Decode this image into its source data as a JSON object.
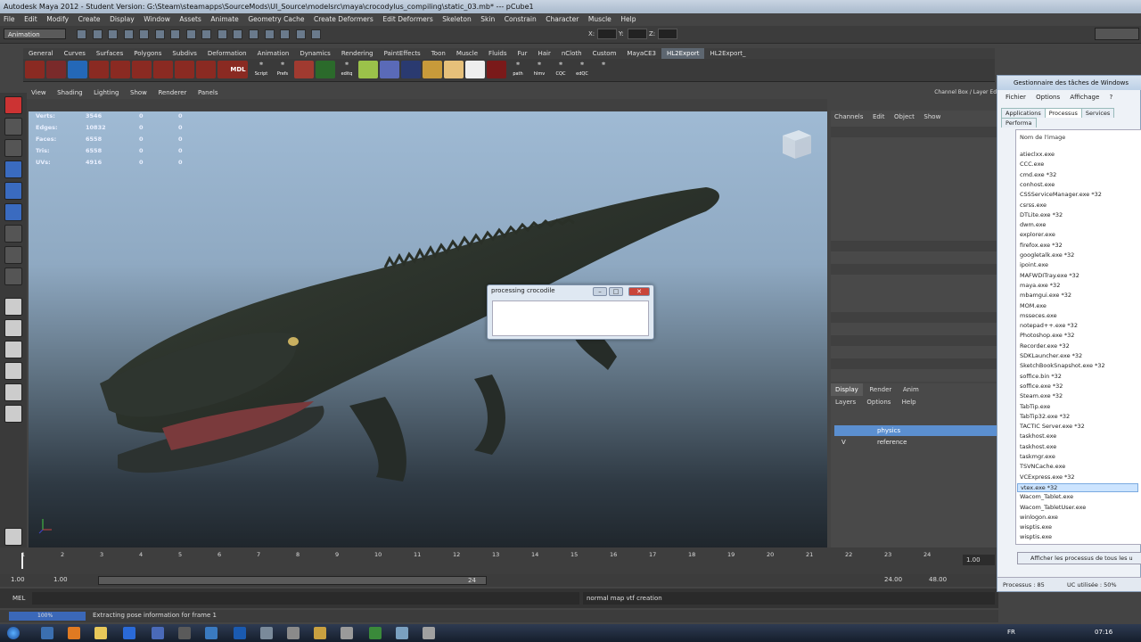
{
  "window_title": "Autodesk Maya 2012 - Student Version: G:\\Steam\\steamapps\\SourceMods\\UI_Source\\modelsrc\\maya\\crocodylus_compiling\\static_03.mb* --- pCube1",
  "menus": [
    "File",
    "Edit",
    "Modify",
    "Create",
    "Display",
    "Window",
    "Assets",
    "Animate",
    "Geometry Cache",
    "Create Deformers",
    "Edit Deformers",
    "Skeleton",
    "Skin",
    "Constrain",
    "Character",
    "Muscle",
    "Help"
  ],
  "mode_dropdown": "Animation",
  "coord_labels": [
    "X:",
    "Y:",
    "Z:"
  ],
  "shelf_tabs": [
    "General",
    "Curves",
    "Surfaces",
    "Polygons",
    "Subdivs",
    "Deformation",
    "Animation",
    "Dynamics",
    "Rendering",
    "PaintEffects",
    "Toon",
    "Muscle",
    "Fluids",
    "Fur",
    "Hair",
    "nCloth",
    "Custom",
    "MayaCE3",
    "HL2Export",
    "HL2Export_"
  ],
  "active_shelf_tab": "HL2Export",
  "shelf_labels": [
    "Script",
    "Prefs",
    "editq",
    "path",
    "hlmv",
    "CQC",
    "edQC",
    "MDL"
  ],
  "panel_menu": [
    "View",
    "Shading",
    "Lighting",
    "Show",
    "Renderer",
    "Panels"
  ],
  "hud": [
    {
      "label": "Verts:",
      "v1": "3546",
      "v2": "0",
      "v3": "0"
    },
    {
      "label": "Edges:",
      "v1": "10832",
      "v2": "0",
      "v3": "0"
    },
    {
      "label": "Faces:",
      "v1": "6558",
      "v2": "0",
      "v3": "0"
    },
    {
      "label": "Tris:",
      "v1": "6558",
      "v2": "0",
      "v3": "0"
    },
    {
      "label": "UVs:",
      "v1": "4916",
      "v2": "0",
      "v3": "0"
    }
  ],
  "dialog": {
    "title": "processing crocodile"
  },
  "channel_box_header": "Channel Box / Layer Ed",
  "channel_menu": [
    "Channels",
    "Edit",
    "Object",
    "Show"
  ],
  "layer_tabs": [
    "Display",
    "Render",
    "Anim"
  ],
  "layer_menu": [
    "Layers",
    "Options",
    "Help"
  ],
  "layers": [
    {
      "name": "physics",
      "v": ""
    },
    {
      "name": "reference",
      "v": "V"
    }
  ],
  "timeline_ticks": [
    "1",
    "2",
    "3",
    "4",
    "5",
    "6",
    "7",
    "8",
    "9",
    "10",
    "11",
    "12",
    "13",
    "14",
    "15",
    "16",
    "17",
    "18",
    "19",
    "20",
    "21",
    "22",
    "23",
    "24"
  ],
  "current_frame": "1.00",
  "range": {
    "start": "1.00",
    "start2": "1.00",
    "mid": "24",
    "end": "24.00",
    "end2": "48.00"
  },
  "mel_label": "MEL",
  "mel_output": "normal map vtf creation",
  "progress_text": "100%",
  "help_text": "Extracting pose information for frame 1",
  "task_manager": {
    "title": "Gestionnaire des tâches de Windows",
    "menu": [
      "Fichier",
      "Options",
      "Affichage",
      "?"
    ],
    "tabs": [
      "Applications",
      "Processus",
      "Services",
      "Performa"
    ],
    "column": "Nom de l'image",
    "processes": [
      "atieclxx.exe",
      "CCC.exe",
      "cmd.exe *32",
      "conhost.exe",
      "CSSServiceManager.exe *32",
      "csrss.exe",
      "DTLite.exe *32",
      "dwm.exe",
      "explorer.exe",
      "firefox.exe *32",
      "googletalk.exe *32",
      "ipoint.exe",
      "MAFWDITray.exe *32",
      "maya.exe *32",
      "mbamgui.exe *32",
      "MOM.exe",
      "msseces.exe",
      "notepad++.exe *32",
      "Photoshop.exe *32",
      "Recorder.exe *32",
      "SDKLauncher.exe *32",
      "SketchBookSnapshot.exe *32",
      "soffice.bin *32",
      "soffice.exe *32",
      "Steam.exe *32",
      "TabTip.exe",
      "TabTip32.exe *32",
      "TACTIC Server.exe *32",
      "taskhost.exe",
      "taskhost.exe",
      "taskmgr.exe",
      "TSVNCache.exe",
      "VCExpress.exe *32",
      "vtex.exe *32",
      "Wacom_Tablet.exe",
      "Wacom_TabletUser.exe",
      "winlogon.exe",
      "wisptis.exe",
      "wisptis.exe"
    ],
    "selected_process": "vtex.exe *32",
    "button": "Afficher les processus de tous les u",
    "status_processes": "Processus : 85",
    "status_cpu": "UC utilisée : 50%"
  },
  "taskbar": {
    "lang": "FR",
    "time": "07:16"
  },
  "colors": {
    "viewport_top": "#9fbad4",
    "viewport_bottom": "#1f262c",
    "selected_layer": "#5b8fd0"
  }
}
